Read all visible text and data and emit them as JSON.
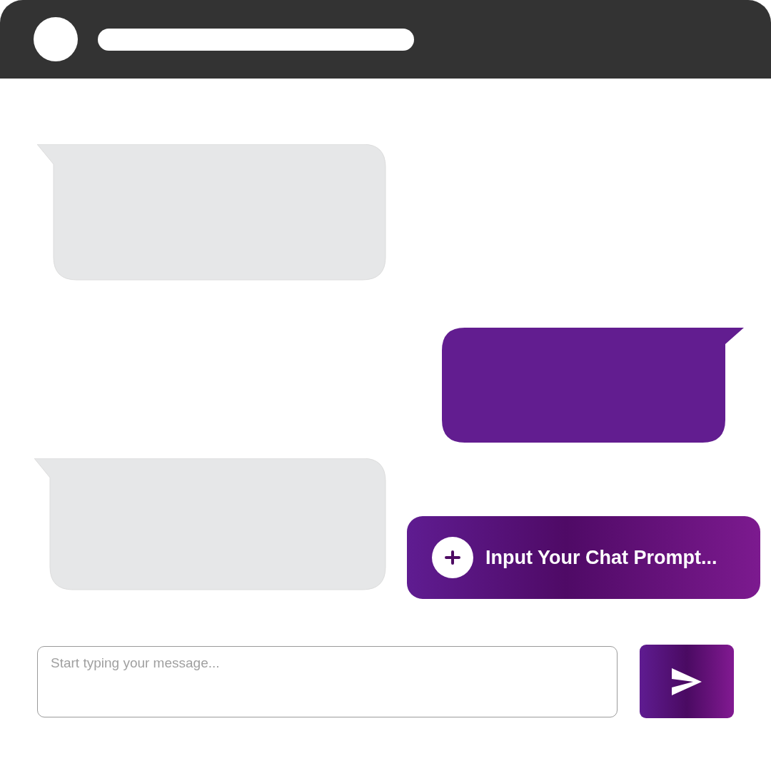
{
  "messages": [
    {
      "kind": "received"
    },
    {
      "kind": "sent"
    },
    {
      "kind": "received"
    }
  ],
  "prompt_button": {
    "label": "Input Your Chat Prompt..."
  },
  "composer": {
    "placeholder": "Start typing your message..."
  }
}
